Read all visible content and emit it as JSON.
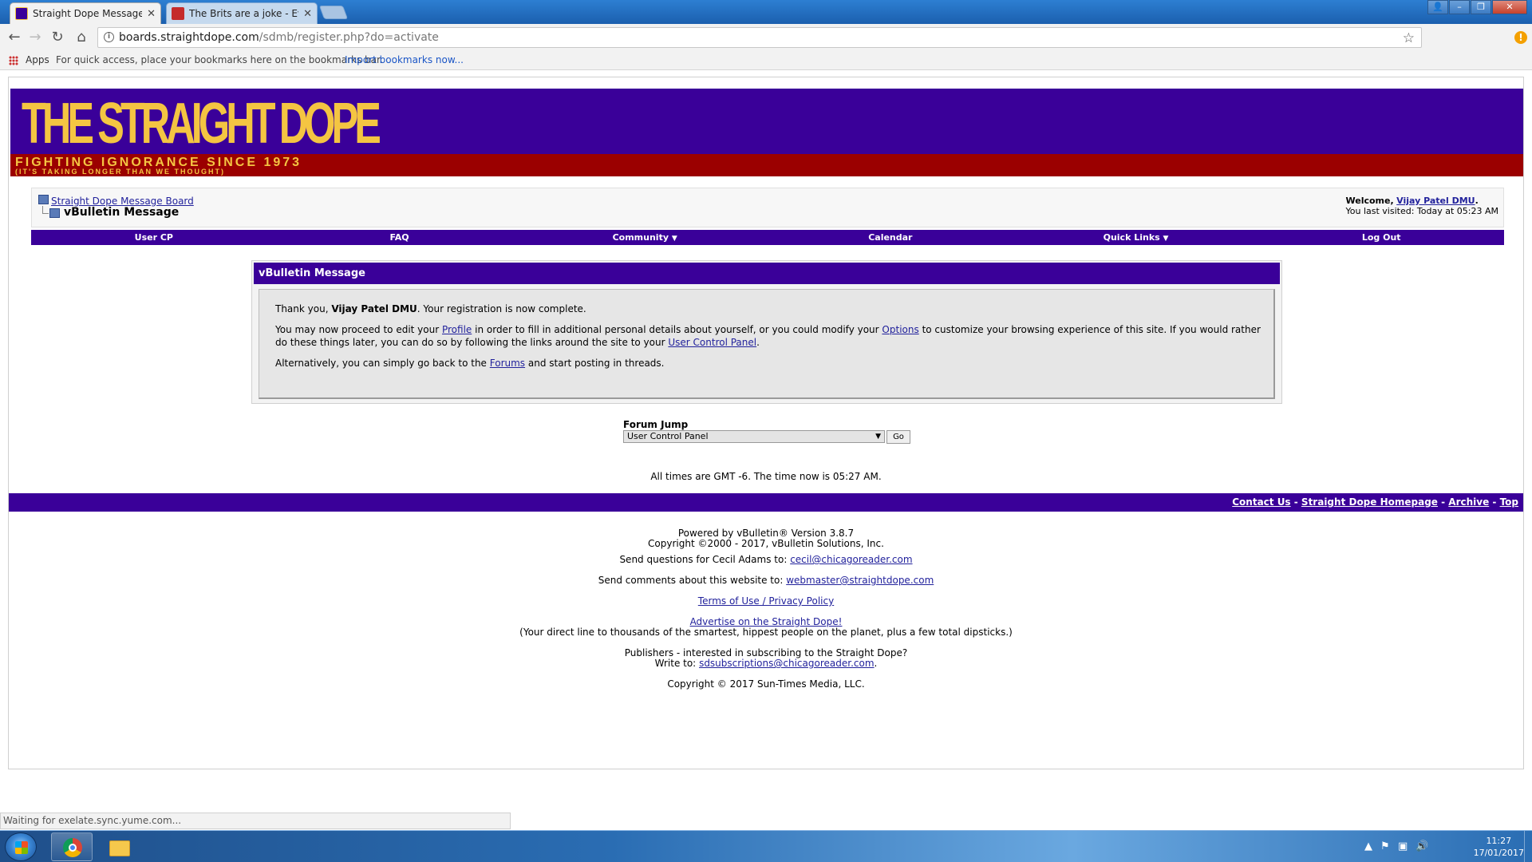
{
  "browser": {
    "tabs": [
      {
        "title": "Straight Dope Message B",
        "active": true
      },
      {
        "title": "The Brits are a joke - Eve",
        "active": false
      }
    ],
    "url_domain": "boards.straightdope.com",
    "url_path": "/sdmb/register.php?do=activate",
    "bookmarks": {
      "apps_label": "Apps",
      "hint_text": "For quick access, place your bookmarks here on the bookmarks bar.",
      "import_link": "Import bookmarks now..."
    },
    "status_text": "Waiting for exelate.sync.yume.com..."
  },
  "banner": {
    "logo": "THE STRAIGHT DOPE",
    "tagline": "FIGHTING IGNORANCE SINCE 1973",
    "subtagline": "(IT'S TAKING LONGER THAN WE THOUGHT)"
  },
  "breadcrumb": {
    "board_link": "Straight Dope Message Board",
    "current": "vBulletin Message"
  },
  "welcome": {
    "prefix": "Welcome,",
    "username": "Vijay Patel DMU",
    "last_visited": "You last visited: Today at 05:23 AM"
  },
  "navbar": {
    "items": [
      "User CP",
      "FAQ",
      "Community",
      "Calendar",
      "Quick Links",
      "Log Out"
    ]
  },
  "message": {
    "header": "vBulletin Message",
    "p1_a": "Thank you,",
    "p1_user": "Vijay Patel DMU",
    "p1_b": ". Your registration is now complete.",
    "p2_a": "You may now proceed to edit your",
    "p2_profile": "Profile",
    "p2_b": "in order to fill in additional personal details about yourself, or you could modify your",
    "p2_options": "Options",
    "p2_c": "to customize your browsing experience of this site. If you would rather do these things later, you can do so by following the links around the site to your",
    "p2_ucp": "User Control Panel",
    "p2_d": ".",
    "p3_a": "Alternatively, you can simply go back to the",
    "p3_forums": "Forums",
    "p3_b": "and start posting in threads."
  },
  "forum_jump": {
    "label": "Forum Jump",
    "selected": "User Control Panel",
    "go": "Go"
  },
  "times_text": "All times are GMT -6. The time now is 05:27 AM.",
  "footer_links": [
    "Contact Us",
    "Straight Dope Homepage",
    "Archive",
    "Top"
  ],
  "footer": {
    "powered": "Powered by vBulletin® Version 3.8.7",
    "copyright_vb": "Copyright ©2000 - 2017, vBulletin Solutions, Inc.",
    "cecil_prefix": "Send questions for Cecil Adams to:",
    "cecil_email": "cecil@chicagoreader.com",
    "web_prefix": "Send comments about this website to:",
    "web_email": "webmaster@straightdope.com",
    "terms": "Terms of Use / Privacy Policy",
    "advertise": "Advertise on the Straight Dope!",
    "advertise_sub": "(Your direct line to thousands of the smartest, hippest people on the planet, plus a few total dipsticks.)",
    "publishers": "Publishers - interested in subscribing to the Straight Dope?",
    "write_prefix": "Write to:",
    "sub_email": "sdsubscriptions@chicagoreader.com",
    "copyright_st": "Copyright © 2017 Sun-Times Media, LLC."
  },
  "taskbar": {
    "time": "11:27",
    "date": "17/01/2017"
  },
  "colors": {
    "banner_purple": "#3a0099",
    "banner_red": "#9b0000",
    "logo_yellow": "#f4c542"
  }
}
